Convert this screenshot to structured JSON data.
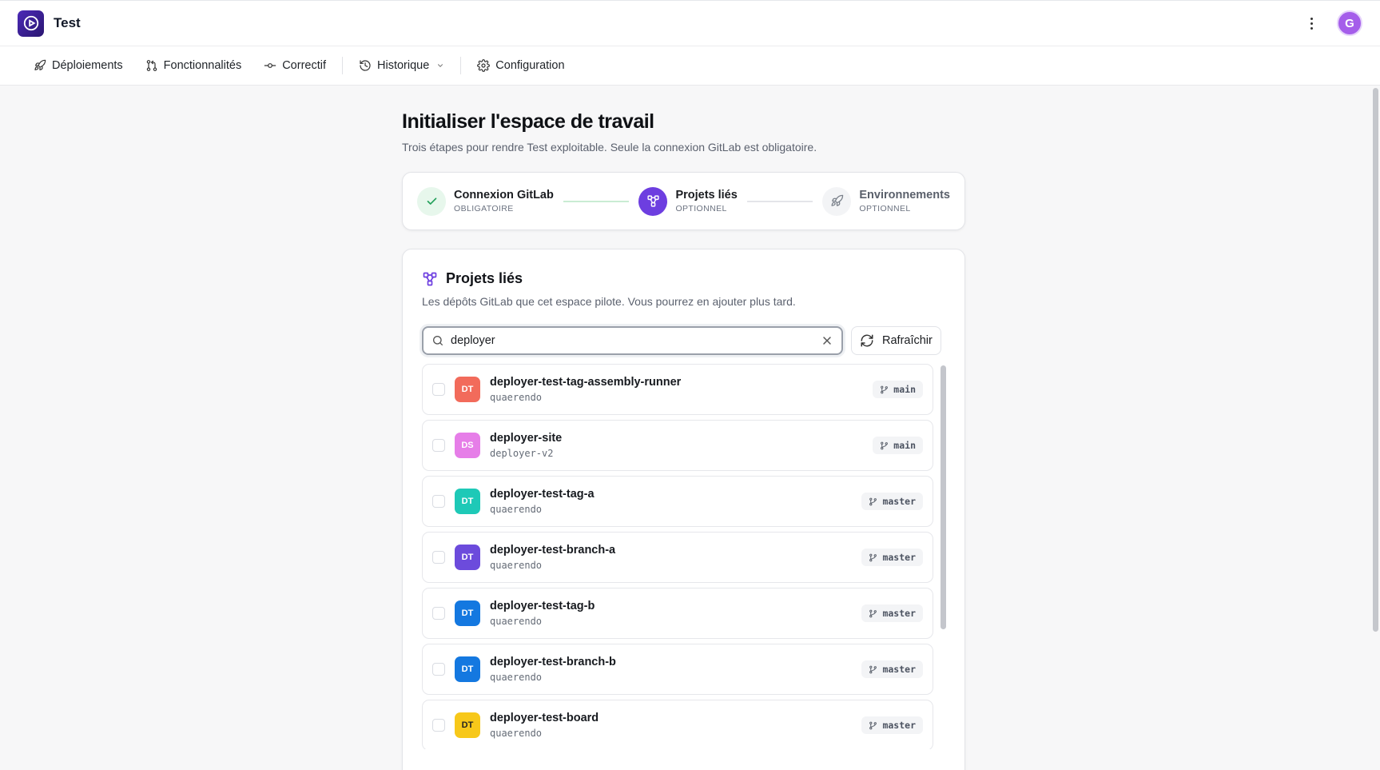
{
  "app": {
    "name": "Test",
    "avatar_initial": "G",
    "brand_color": "#4c2ab8",
    "accent_color": "#6d3ee0"
  },
  "nav": {
    "items": [
      {
        "label": "Déploiements",
        "icon": "rocket-icon"
      },
      {
        "label": "Fonctionnalités",
        "icon": "git-pull-request-icon"
      },
      {
        "label": "Correctif",
        "icon": "git-commit-icon"
      },
      {
        "label": "Historique",
        "icon": "history-icon"
      },
      {
        "label": "Configuration",
        "icon": "gear-icon"
      }
    ]
  },
  "page": {
    "title": "Initialiser l'espace de travail",
    "subtitle": "Trois étapes pour rendre Test exploitable. Seule la connexion GitLab est obligatoire."
  },
  "stepper": {
    "steps": [
      {
        "label": "Connexion GitLab",
        "sub": "OBLIGATOIRE",
        "state": "done"
      },
      {
        "label": "Projets liés",
        "sub": "OPTIONNEL",
        "state": "active"
      },
      {
        "label": "Environnements",
        "sub": "OPTIONNEL",
        "state": "pending"
      }
    ]
  },
  "projects_card": {
    "title": "Projets liés",
    "description": "Les dépôts GitLab que cet espace pilote. Vous pourrez en ajouter plus tard.",
    "search_value": "deployer",
    "refresh_label": "Rafraîchir",
    "rows": [
      {
        "initials": "DT",
        "color": "#f26b5b",
        "name": "deployer-test-tag-assembly-runner",
        "namespace": "quaerendo",
        "branch": "main"
      },
      {
        "initials": "DS",
        "color": "#e67ee8",
        "name": "deployer-site",
        "namespace": "deployer-v2",
        "branch": "main"
      },
      {
        "initials": "DT",
        "color": "#1ec9b7",
        "name": "deployer-test-tag-a",
        "namespace": "quaerendo",
        "branch": "master"
      },
      {
        "initials": "DT",
        "color": "#6c4bdc",
        "name": "deployer-test-branch-a",
        "namespace": "quaerendo",
        "branch": "master"
      },
      {
        "initials": "DT",
        "color": "#1478e0",
        "name": "deployer-test-tag-b",
        "namespace": "quaerendo",
        "branch": "master"
      },
      {
        "initials": "DT",
        "color": "#1478e0",
        "name": "deployer-test-branch-b",
        "namespace": "quaerendo",
        "branch": "master"
      },
      {
        "initials": "DT",
        "color": "#f7c81a",
        "name": "deployer-test-board",
        "namespace": "quaerendo",
        "branch": "master"
      }
    ]
  }
}
